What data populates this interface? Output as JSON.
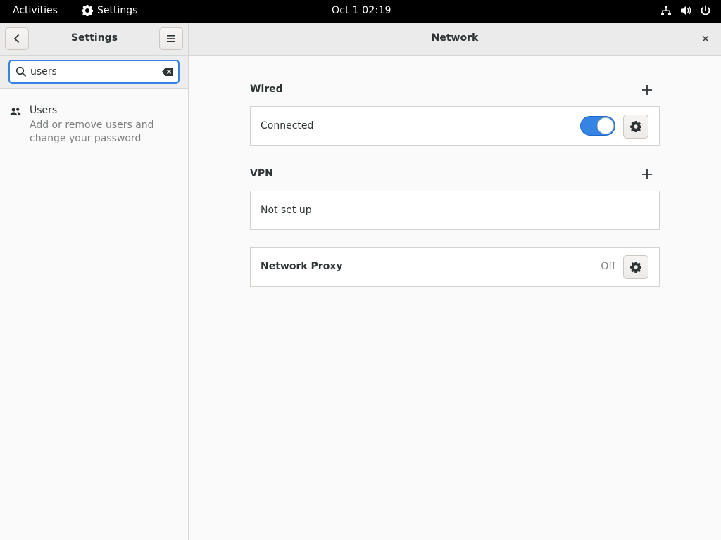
{
  "topbar": {
    "activities": "Activities",
    "app_name": "Settings",
    "clock": "Oct 1  02:19"
  },
  "sidebar": {
    "title": "Settings",
    "search": {
      "value": "users",
      "placeholder": ""
    },
    "results": [
      {
        "title": "Users",
        "description": "Add or remove users and change your password"
      }
    ]
  },
  "main": {
    "title": "Network",
    "sections": {
      "wired": {
        "label": "Wired",
        "row_label": "Connected",
        "enabled": true
      },
      "vpn": {
        "label": "VPN",
        "row_label": "Not set up"
      },
      "proxy": {
        "row_label": "Network Proxy",
        "status": "Off"
      }
    }
  },
  "colors": {
    "accent": "#3584e4",
    "topbar_bg": "#000000",
    "header_bg": "#ebebeb",
    "text": "#2e3436",
    "dim_text": "#7c7f7e"
  },
  "icons": {
    "app_icon": "gear-icon",
    "tray": [
      "network-wired-icon",
      "volume-icon",
      "power-icon"
    ],
    "back": "chevron-left-icon",
    "menu": "hamburger-menu-icon",
    "close": "close-icon",
    "search": "search-icon",
    "clear": "clear-text-icon",
    "users": "users-icon",
    "add": "plus-icon",
    "settings": "gear-icon"
  }
}
